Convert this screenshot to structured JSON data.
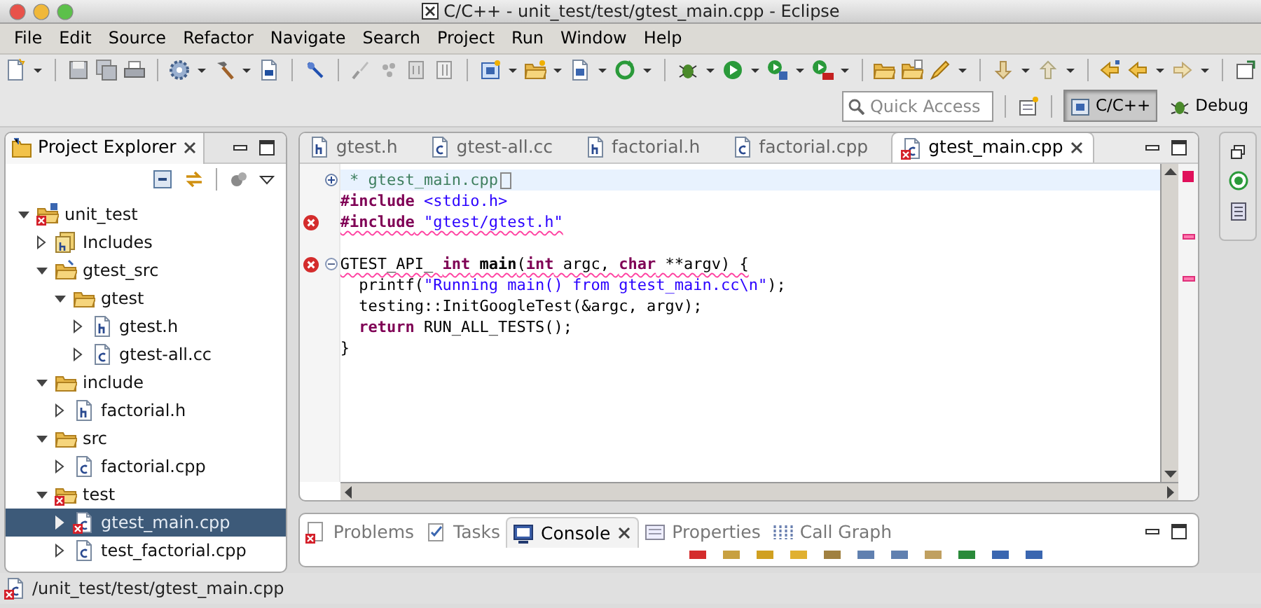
{
  "window": {
    "title": "C/C++ - unit_test/test/gtest_main.cpp - Eclipse"
  },
  "menu": [
    "File",
    "Edit",
    "Source",
    "Refactor",
    "Navigate",
    "Search",
    "Project",
    "Run",
    "Window",
    "Help"
  ],
  "quick_access": {
    "placeholder": "Quick Access"
  },
  "perspectives": [
    {
      "label": "C/C++",
      "selected": true
    },
    {
      "label": "Debug",
      "selected": false
    }
  ],
  "project_explorer": {
    "title": "Project Explorer",
    "tree": [
      {
        "label": "unit_test",
        "kind": "project",
        "error": true,
        "expanded": true,
        "selected": false,
        "children": [
          {
            "label": "Includes",
            "kind": "includes",
            "error": false,
            "expanded": false,
            "selected": false
          },
          {
            "label": "gtest_src",
            "kind": "source-folder",
            "error": false,
            "expanded": true,
            "selected": false,
            "children": [
              {
                "label": "gtest",
                "kind": "folder",
                "error": false,
                "expanded": true,
                "selected": false,
                "children": [
                  {
                    "label": "gtest.h",
                    "kind": "header",
                    "error": false,
                    "expanded": false,
                    "selected": false
                  },
                  {
                    "label": "gtest-all.cc",
                    "kind": "source",
                    "error": false,
                    "expanded": false,
                    "selected": false
                  }
                ]
              }
            ]
          },
          {
            "label": "include",
            "kind": "folder",
            "error": false,
            "expanded": true,
            "selected": false,
            "children": [
              {
                "label": "factorial.h",
                "kind": "header",
                "error": false,
                "expanded": false,
                "selected": false
              }
            ]
          },
          {
            "label": "src",
            "kind": "folder",
            "error": false,
            "expanded": true,
            "selected": false,
            "children": [
              {
                "label": "factorial.cpp",
                "kind": "source",
                "error": false,
                "expanded": false,
                "selected": false
              }
            ]
          },
          {
            "label": "test",
            "kind": "folder",
            "error": true,
            "expanded": true,
            "selected": false,
            "children": [
              {
                "label": "gtest_main.cpp",
                "kind": "source",
                "error": true,
                "expanded": false,
                "selected": true
              },
              {
                "label": "test_factorial.cpp",
                "kind": "source",
                "error": false,
                "expanded": false,
                "selected": false
              }
            ]
          }
        ]
      }
    ]
  },
  "editor": {
    "tabs": [
      {
        "label": "gtest.h",
        "kind": "header",
        "error": false,
        "selected": false
      },
      {
        "label": "gtest-all.cc",
        "kind": "source",
        "error": false,
        "selected": false
      },
      {
        "label": "factorial.h",
        "kind": "header",
        "error": false,
        "selected": false
      },
      {
        "label": "factorial.cpp",
        "kind": "source",
        "error": false,
        "selected": false
      },
      {
        "label": "gtest_main.cpp",
        "kind": "source",
        "error": true,
        "selected": true
      }
    ],
    "lines": [
      {
        "current": true,
        "error": false,
        "folded": true,
        "tokens": [
          {
            "kind": "comment",
            "text": " * gtest_main.cpp"
          }
        ]
      },
      {
        "current": false,
        "error": false,
        "tokens": [
          {
            "kind": "directive",
            "text": "#include"
          },
          {
            "kind": "string",
            "text": " <stdio.h>"
          }
        ]
      },
      {
        "current": false,
        "error": true,
        "tokens": [
          {
            "kind": "directive",
            "text": "#include"
          },
          {
            "kind": "string",
            "text": " \"gtest/gtest.h\""
          }
        ]
      },
      {
        "current": false,
        "error": false
      },
      {
        "current": false,
        "error": true,
        "folded": false,
        "tokens": [
          {
            "kind": "plain",
            "text": "GTEST_API_ "
          },
          {
            "kind": "keyword",
            "text": "int"
          },
          {
            "kind": "function",
            "text": " main"
          },
          {
            "kind": "plain",
            "text": "("
          },
          {
            "kind": "keyword",
            "text": "int"
          },
          {
            "kind": "plain",
            "text": " argc, "
          },
          {
            "kind": "keyword",
            "text": "char"
          },
          {
            "kind": "plain",
            "text": " **argv) {"
          }
        ]
      },
      {
        "current": false,
        "error": false,
        "tokens": [
          {
            "kind": "plain",
            "text": "  printf("
          },
          {
            "kind": "string",
            "text": "\"Running main() from gtest_main.cc\\n\""
          },
          {
            "kind": "plain",
            "text": ");"
          }
        ]
      },
      {
        "current": false,
        "error": false,
        "tokens": [
          {
            "kind": "plain",
            "text": "  testing::InitGoogleTest(&argc, argv);"
          }
        ]
      },
      {
        "current": false,
        "error": false,
        "tokens": [
          {
            "kind": "keyword",
            "text": "  return"
          },
          {
            "kind": "plain",
            "text": " RUN_ALL_TESTS();"
          }
        ]
      },
      {
        "current": false,
        "error": false,
        "tokens": [
          {
            "kind": "plain",
            "text": "}"
          }
        ]
      }
    ]
  },
  "bottom_panel": {
    "tabs": [
      {
        "label": "Problems",
        "kind": "problems",
        "selected": false
      },
      {
        "label": "Tasks",
        "kind": "tasks",
        "selected": false
      },
      {
        "label": "Console",
        "kind": "console",
        "selected": true
      },
      {
        "label": "Properties",
        "kind": "properties",
        "selected": false
      },
      {
        "label": "Call Graph",
        "kind": "callgraph",
        "selected": false
      }
    ]
  },
  "status_bar": {
    "path": "/unit_test/test/gtest_main.cpp",
    "error": true
  }
}
